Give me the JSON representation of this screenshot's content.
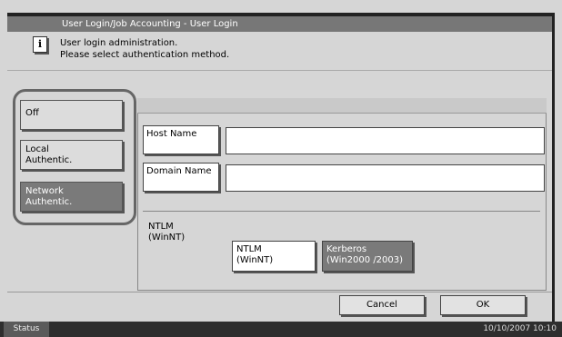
{
  "title": "User Login/Job Accounting - User Login",
  "message": {
    "icon": "info-icon",
    "line1": "User login administration.",
    "line2": "Please select authentication method."
  },
  "auth_methods": {
    "off": "Off",
    "local_l1": "Local",
    "local_l2": "Authentic.",
    "network_l1": "Network",
    "network_l2": "Authentic.",
    "selected": "Network Authentic."
  },
  "fields": {
    "host_name_label": "Host Name",
    "host_name_value": "",
    "domain_name_label": "Domain Name",
    "domain_name_value": ""
  },
  "ntlm": {
    "label_l1": "NTLM",
    "label_l2": "(WinNT)",
    "opt_ntlm_l1": "NTLM",
    "opt_ntlm_l2": "(WinNT)",
    "opt_kerb_l1": "Kerberos",
    "opt_kerb_l2": "(Win2000 /2003)",
    "selected": "Kerberos (Win2000 /2003)"
  },
  "footer": {
    "cancel": "Cancel",
    "ok": "OK"
  },
  "status": {
    "tab": "Status",
    "datetime": "10/10/2007   10:10"
  },
  "colors": {
    "selected": "#7a7a7a",
    "titlebar": "#777777",
    "statusbar": "#2e2e2e"
  }
}
